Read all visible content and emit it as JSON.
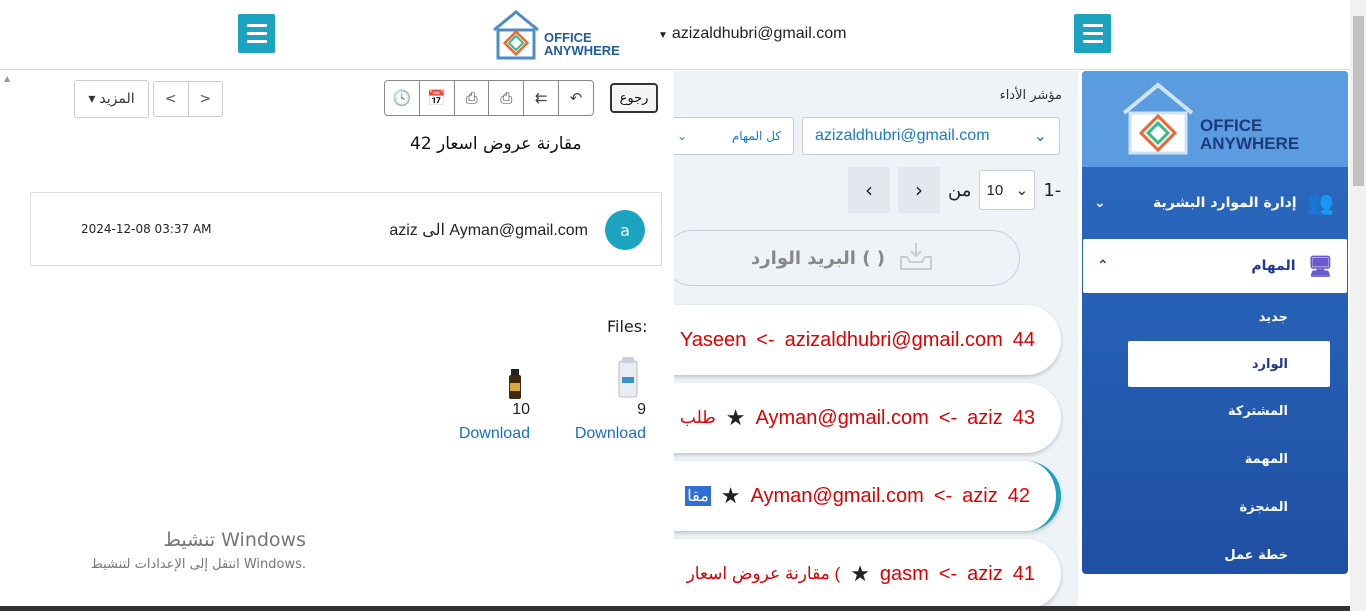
{
  "header": {
    "user_email": "azizaldhubri@gmail.com",
    "logo_text": "OFFICE ANYWHERE"
  },
  "sidebar": {
    "logo_text": "OFFICE ANYWHERE",
    "hr_label": "إدارة الموارد البشرية",
    "tasks_label": "المهام",
    "items": [
      {
        "label": "جديد"
      },
      {
        "label": "الوارد"
      },
      {
        "label": "المشتركة"
      },
      {
        "label": "المهمة"
      },
      {
        "label": "المنجزة"
      },
      {
        "label": "خطة عمل"
      }
    ]
  },
  "middle": {
    "perf_label": "مؤشر الأداء",
    "email_filter": "azizaldhubri@gmail.com",
    "all_tasks": "كل المهام",
    "page_size": "10",
    "of_label": "من",
    "range_label": "1-",
    "inbox_label": "البريد الوارد ( )",
    "rows": [
      {
        "id": "44",
        "sender": "azizaldhubri@gmail.com",
        "arrow": "<-",
        "to": "Yaseen",
        "subject": ""
      },
      {
        "id": "43",
        "sender": "aziz",
        "arrow": "<-",
        "to": "Ayman@gmail.com",
        "subject": "طلب"
      },
      {
        "id": "42",
        "sender": "aziz",
        "arrow": "<-",
        "to": "Ayman@gmail.com",
        "subject": "مقا"
      },
      {
        "id": "41",
        "sender": "aziz",
        "arrow": "<-",
        "to": "gasm",
        "subject": "مقارنة عروض اسعار ("
      }
    ]
  },
  "detail": {
    "more_label": "المزيد",
    "prev_label": "<",
    "next_label": ">",
    "back_label": "رجوع",
    "subject": "مقارنة عروض اسعار  42",
    "avatar_letter": "a",
    "from_line": "aziz الى   Ayman@gmail.com",
    "date": "2024-12-08 03:37 AM",
    "files_label": "Files:",
    "files": [
      {
        "num": "9",
        "download": "Download"
      },
      {
        "num": "10",
        "download": "Download"
      }
    ]
  },
  "watermark": {
    "title": "تنشيط Windows",
    "subtitle": "انتقل إلى الإعدادات لتنشيط Windows."
  },
  "colors": {
    "accent": "#1ba3bf",
    "sidebar": "#2d6fc4",
    "row_text": "#dd0000"
  }
}
